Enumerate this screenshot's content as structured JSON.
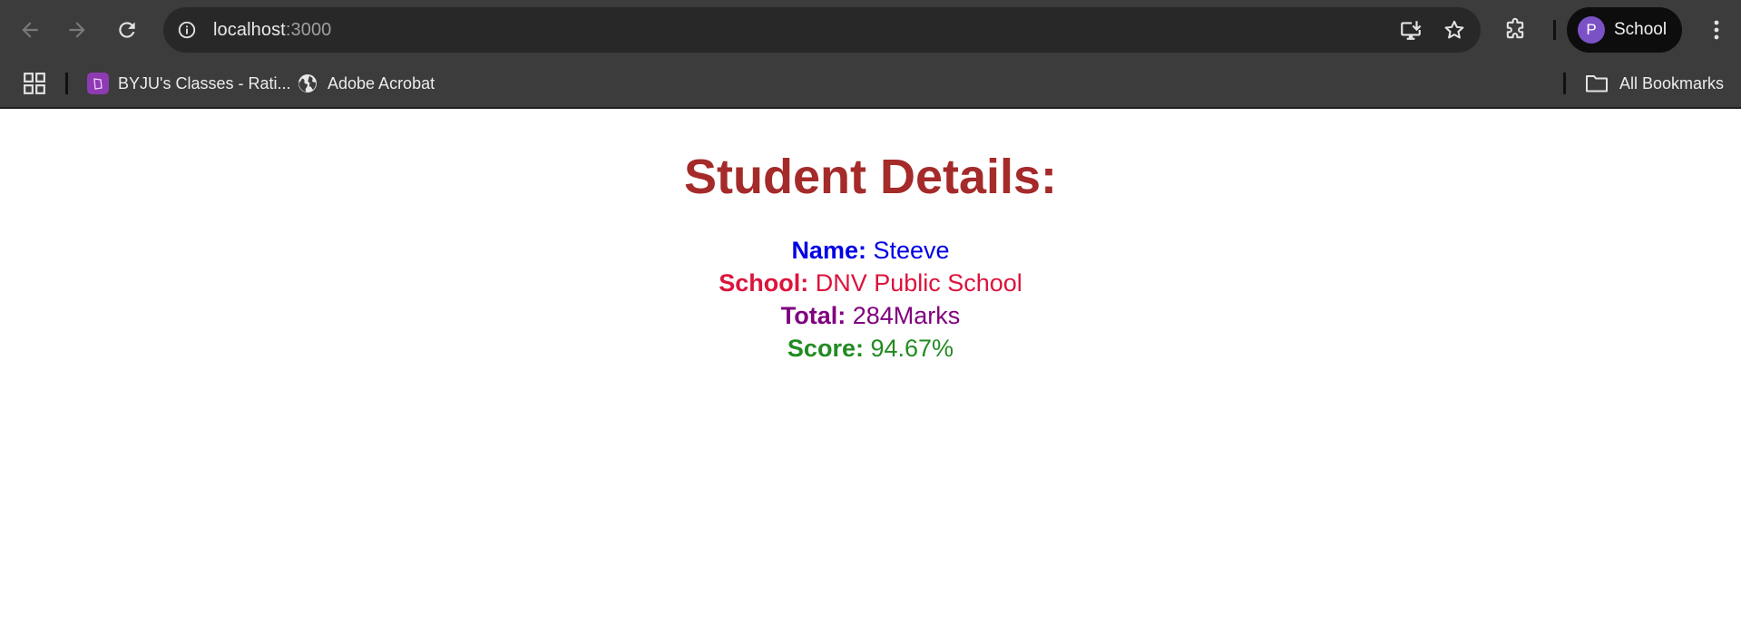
{
  "browser": {
    "url_host": "localhost",
    "url_port": ":3000",
    "profile_initial": "P",
    "profile_name": "School",
    "colors": {
      "toolbar": "#3c3c3c",
      "omnibox": "#282828",
      "avatar": "#7b52c6"
    }
  },
  "bookmarks": {
    "items": [
      {
        "label": "BYJU's Classes - Rati...",
        "icon": "byjus-icon"
      },
      {
        "label": "Adobe Acrobat",
        "icon": "globe-icon"
      }
    ],
    "all_label": "All Bookmarks"
  },
  "page": {
    "title": "Student Details:",
    "title_color": "#a52a2a",
    "details": [
      {
        "label": "Name:",
        "value": "Steeve",
        "color": "#0000e6"
      },
      {
        "label": "School:",
        "value": "DNV Public School",
        "color": "#dc143c"
      },
      {
        "label": "Total:",
        "value": "284Marks",
        "color": "#800080"
      },
      {
        "label": "Score:",
        "value": "94.67%",
        "color": "#228b22"
      }
    ]
  }
}
